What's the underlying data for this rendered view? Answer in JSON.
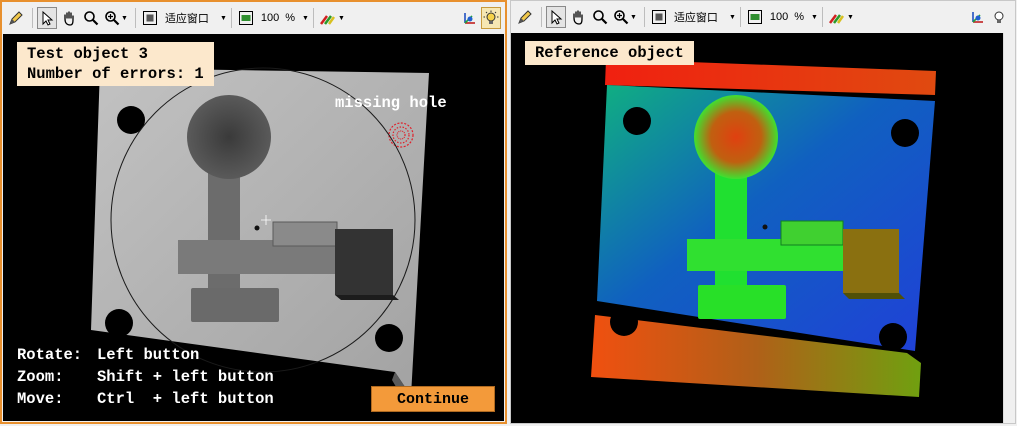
{
  "toolbar": {
    "fit_window_label": "适应窗口",
    "zoom_value": "100",
    "zoom_unit": "%"
  },
  "left_view": {
    "title_line1": "Test object 3",
    "title_line2": "Number of errors: 1",
    "error_annotation": "missing hole",
    "hints": [
      {
        "action": "Rotate:",
        "binding": "Left button"
      },
      {
        "action": "Zoom:",
        "binding": "Shift + left button"
      },
      {
        "action": "Move:",
        "binding": "Ctrl  + left button"
      }
    ],
    "continue_label": "Continue"
  },
  "right_view": {
    "title": "Reference object"
  },
  "colors": {
    "active_border": "#e8902e",
    "label_bg": "#fce8cc",
    "continue_bg": "#f39a3a",
    "error_marker": "#e0202a"
  }
}
